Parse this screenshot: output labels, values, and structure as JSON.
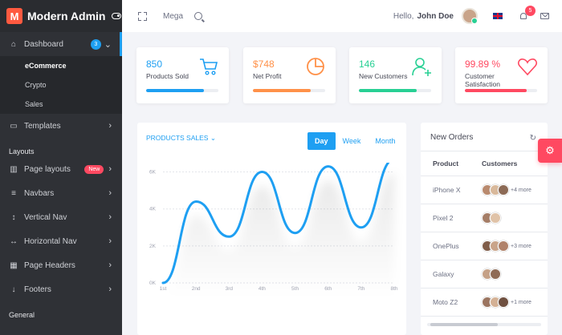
{
  "brand": {
    "logo_letter": "M",
    "name": "Modern Admin"
  },
  "sidebar": {
    "dashboard": {
      "label": "Dashboard",
      "badge": "3",
      "icon": "home-icon"
    },
    "dashboard_sub": [
      "eCommerce",
      "Crypto",
      "Sales"
    ],
    "templates": {
      "label": "Templates",
      "icon": "monitor-icon"
    },
    "section_layouts": "Layouts",
    "layout_items": [
      {
        "label": "Page layouts",
        "icon": "columns-icon",
        "badge": "New"
      },
      {
        "label": "Navbars",
        "icon": "bars-icon"
      },
      {
        "label": "Vertical Nav",
        "icon": "vertical-arrows-icon"
      },
      {
        "label": "Horizontal Nav",
        "icon": "horizontal-arrows-icon"
      },
      {
        "label": "Page Headers",
        "icon": "grid-icon"
      },
      {
        "label": "Footers",
        "icon": "arrow-down-icon"
      }
    ],
    "section_general": "General"
  },
  "topbar": {
    "mega": "Mega",
    "hello": "Hello,",
    "user": "John Doe",
    "notifications": "5"
  },
  "stats": [
    {
      "value": "850",
      "label": "Products Sold",
      "color": "#1e9ff2",
      "progress": 0.8
    },
    {
      "value": "$748",
      "label": "Net Profit",
      "color": "#ff9149",
      "progress": 0.8
    },
    {
      "value": "146",
      "label": "New Customers",
      "color": "#28d094",
      "progress": 0.8
    },
    {
      "value": "99.89 %",
      "label": "Customer Satisfaction",
      "color": "#ff4961",
      "progress": 0.85
    }
  ],
  "chart": {
    "title": "PRODUCTS SALES",
    "tabs": [
      "Day",
      "Week",
      "Month"
    ],
    "active_tab": "Day"
  },
  "chart_data": {
    "type": "line",
    "title": "PRODUCTS SALES",
    "categories": [
      "1st",
      "2nd",
      "3rd",
      "4th",
      "5th",
      "6th",
      "7th",
      "8th"
    ],
    "y_ticks": [
      "0K",
      "2K",
      "4K",
      "6K"
    ],
    "ylim": [
      0,
      6.5
    ],
    "series": [
      {
        "values": [
          0,
          4.4,
          2.5,
          6.0,
          2.7,
          6.3,
          3.0,
          6.7
        ]
      }
    ],
    "grid": true,
    "color": "#1e9ff2"
  },
  "orders": {
    "title": "New Orders",
    "headers": [
      "Product",
      "Customers"
    ],
    "rows": [
      {
        "product": "iPhone X",
        "avatars": 3,
        "more": "+4 more"
      },
      {
        "product": "Pixel 2",
        "avatars": 2,
        "more": ""
      },
      {
        "product": "OnePlus",
        "avatars": 3,
        "more": "+3 more"
      },
      {
        "product": "Galaxy",
        "avatars": 2,
        "more": ""
      },
      {
        "product": "Moto Z2",
        "avatars": 3,
        "more": "+1 more"
      }
    ]
  }
}
